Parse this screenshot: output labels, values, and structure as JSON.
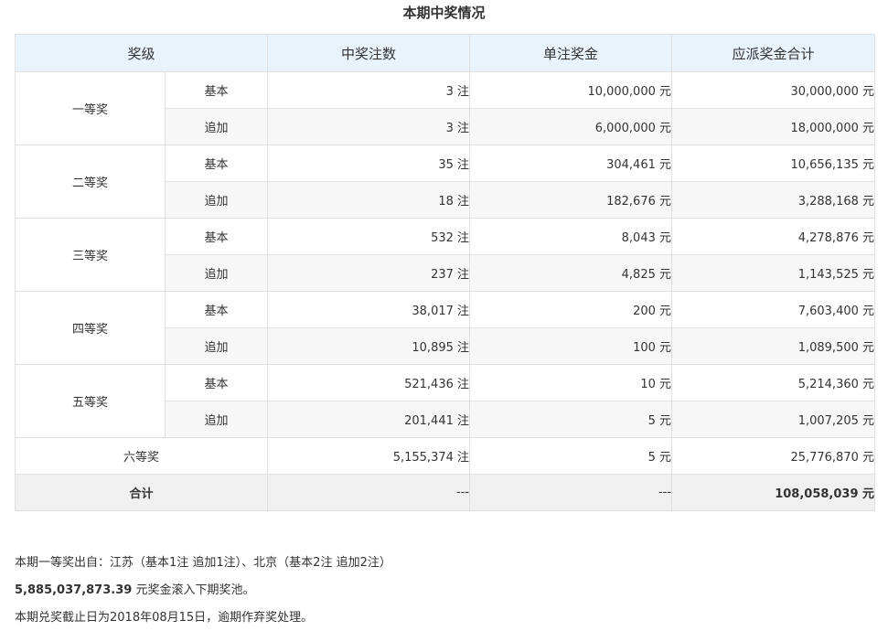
{
  "title": "本期中奖情况",
  "headers": [
    "奖级",
    "中奖注数",
    "单注奖金",
    "应派奖金合计"
  ],
  "prizes": [
    {
      "level": "一等奖",
      "rows": [
        {
          "type": "基本",
          "count": "3 注",
          "unit": "10,000,000 元",
          "total": "30,000,000 元"
        },
        {
          "type": "追加",
          "count": "3 注",
          "unit": "6,000,000 元",
          "total": "18,000,000 元"
        }
      ]
    },
    {
      "level": "二等奖",
      "rows": [
        {
          "type": "基本",
          "count": "35 注",
          "unit": "304,461 元",
          "total": "10,656,135 元"
        },
        {
          "type": "追加",
          "count": "18 注",
          "unit": "182,676 元",
          "total": "3,288,168 元"
        }
      ]
    },
    {
      "level": "三等奖",
      "rows": [
        {
          "type": "基本",
          "count": "532 注",
          "unit": "8,043 元",
          "total": "4,278,876 元"
        },
        {
          "type": "追加",
          "count": "237 注",
          "unit": "4,825 元",
          "total": "1,143,525 元"
        }
      ]
    },
    {
      "level": "四等奖",
      "rows": [
        {
          "type": "基本",
          "count": "38,017 注",
          "unit": "200 元",
          "total": "7,603,400 元"
        },
        {
          "type": "追加",
          "count": "10,895 注",
          "unit": "100 元",
          "total": "1,089,500 元"
        }
      ]
    },
    {
      "level": "五等奖",
      "rows": [
        {
          "type": "基本",
          "count": "521,436 注",
          "unit": "10 元",
          "total": "5,214,360 元"
        },
        {
          "type": "追加",
          "count": "201,441 注",
          "unit": "5 元",
          "total": "1,007,205 元"
        }
      ]
    }
  ],
  "sixth": {
    "level": "六等奖",
    "count": "5,155,374 注",
    "unit": "5 元",
    "total": "25,776,870 元"
  },
  "sum": {
    "label": "合计",
    "count": "---",
    "unit": "---",
    "total": "108,058,039 元"
  },
  "notes": {
    "line1": "本期一等奖出自：江苏（基本1注 追加1注）、北京（基本2注 追加2注）",
    "pool_amount": "5,885,037,873.39",
    "pool_text": " 元奖金滚入下期奖池。",
    "line3": "本期兑奖截止日为2018年08月15日，逾期作弃奖处理。"
  }
}
